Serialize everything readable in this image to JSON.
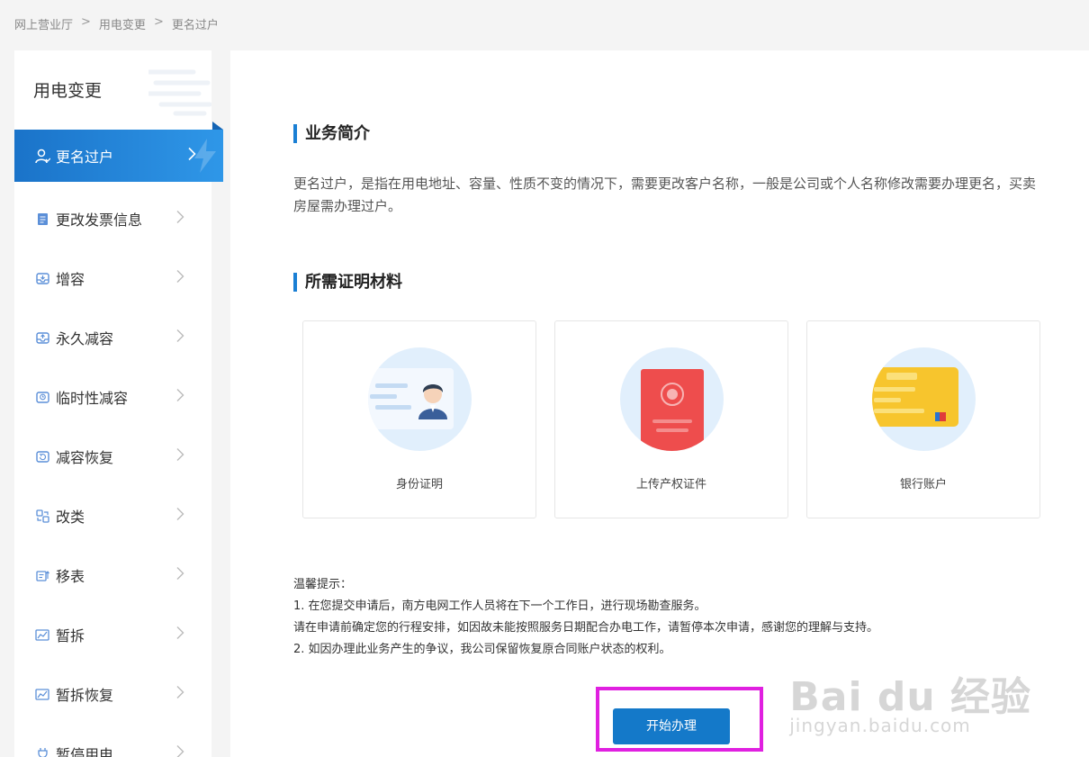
{
  "breadcrumb": [
    "网上营业厅",
    "用电变更",
    "更名过户"
  ],
  "breadcrumb_separator": ">",
  "sidebar": {
    "title": "用电变更",
    "items": [
      {
        "label": "更名过户",
        "icon": "user-icon",
        "active": true
      },
      {
        "label": "更改发票信息",
        "icon": "invoice-icon",
        "active": false
      },
      {
        "label": "增容",
        "icon": "tray-icon",
        "active": false
      },
      {
        "label": "永久减容",
        "icon": "tray-icon",
        "active": false
      },
      {
        "label": "临时性减容",
        "icon": "tray-clock-icon",
        "active": false
      },
      {
        "label": "减容恢复",
        "icon": "restore-icon",
        "active": false
      },
      {
        "label": "改类",
        "icon": "swap-icon",
        "active": false
      },
      {
        "label": "移表",
        "icon": "meter-icon",
        "active": false
      },
      {
        "label": "暂拆",
        "icon": "chart-icon",
        "active": false
      },
      {
        "label": "暂拆恢复",
        "icon": "chart-icon",
        "active": false
      },
      {
        "label": "暂停用电",
        "icon": "plug-icon",
        "active": false
      }
    ]
  },
  "main": {
    "intro_title": "业务简介",
    "intro_text": "更名过户，是指在用电地址、容量、性质不变的情况下，需要更改客户名称，一般是公司或个人名称修改需要办理更名，买卖房屋需办理过户。",
    "materials_title": "所需证明材料",
    "materials": [
      {
        "label": "身份证明",
        "icon": "id-card-icon"
      },
      {
        "label": "上传产权证件",
        "icon": "property-certificate-icon"
      },
      {
        "label": "银行账户",
        "icon": "bank-card-icon"
      }
    ],
    "tips": [
      "温馨提示：",
      "1. 在您提交申请后，南方电网工作人员将在下一个工作日，进行现场勘查服务。",
      "请在申请前确定您的行程安排，如因故未能按照服务日期配合办电工作，请暂停本次申请，感谢您的理解与支持。",
      "2. 如因办理此业务产生的争议，我公司保留恢复原合同账户状态的权利。"
    ],
    "start_button": "开始办理"
  },
  "watermark": {
    "top": "Bai du 经验",
    "bottom": "jingyan.baidu.com"
  },
  "colors": {
    "accent": "#1479c9",
    "highlight": "#e020e0",
    "page_bg": "#f4f4f4"
  }
}
